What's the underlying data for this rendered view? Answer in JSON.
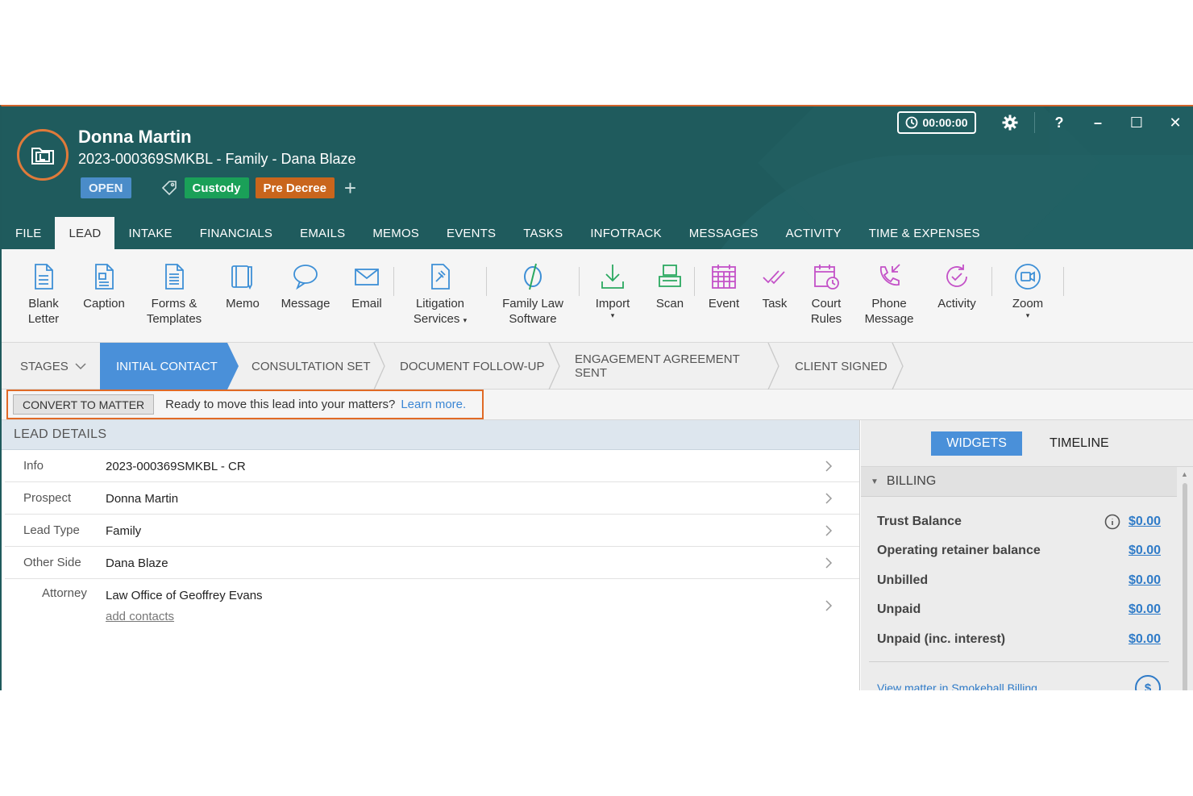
{
  "header": {
    "title": "Donna Martin",
    "subtitle": "2023-000369SMKBL - Family - Dana Blaze",
    "status": "OPEN",
    "tags": [
      "Custody",
      "Pre Decree"
    ],
    "timer": "00:00:00",
    "colors": {
      "header_bg": "#1f5b5d",
      "accent": "#d0642b",
      "custody": "#1aa058",
      "predecree": "#c9651c",
      "open": "#4a8cc9"
    }
  },
  "window": {
    "help": "?",
    "minimize": "–",
    "maximize": "☐",
    "close": "✕"
  },
  "tabs": [
    "FILE",
    "LEAD",
    "INTAKE",
    "FINANCIALS",
    "EMAILS",
    "MEMOS",
    "EVENTS",
    "TASKS",
    "INFOTRACK",
    "MESSAGES",
    "ACTIVITY",
    "TIME & EXPENSES"
  ],
  "active_tab": "LEAD",
  "ribbon": {
    "blank_letter": [
      "Blank",
      "Letter"
    ],
    "caption": "Caption",
    "forms": [
      "Forms &",
      "Templates"
    ],
    "memo": "Memo",
    "message": "Message",
    "email": "Email",
    "litigation": [
      "Litigation",
      "Services"
    ],
    "family_law": [
      "Family Law",
      "Software"
    ],
    "import": "Import",
    "scan": "Scan",
    "event": "Event",
    "task": "Task",
    "court_rules": [
      "Court",
      "Rules"
    ],
    "phone_message": [
      "Phone",
      "Message"
    ],
    "activity": "Activity",
    "zoom": "Zoom",
    "caret": "▾"
  },
  "stages": {
    "menu": "STAGES",
    "items": [
      "INITIAL CONTACT",
      "CONSULTATION SET",
      "DOCUMENT FOLLOW-UP",
      "ENGAGEMENT AGREEMENT SENT",
      "CLIENT SIGNED"
    ],
    "active": "INITIAL CONTACT"
  },
  "convert": {
    "button": "CONVERT TO MATTER",
    "text": "Ready to move this lead into your matters?",
    "link": "Learn more."
  },
  "lead_details": {
    "heading": "LEAD DETAILS",
    "rows": [
      {
        "label": "Info",
        "value": "2023-000369SMKBL - CR"
      },
      {
        "label": "Prospect",
        "value": "Donna Martin"
      },
      {
        "label": "Lead Type",
        "value": "Family"
      },
      {
        "label": "Other Side",
        "value": "Dana Blaze"
      },
      {
        "label": "Attorney",
        "value": "Law Office of Geoffrey Evans"
      }
    ],
    "add_contacts": "add contacts"
  },
  "side_panel": {
    "tabs": [
      "WIDGETS",
      "TIMELINE"
    ],
    "active": "WIDGETS",
    "billing": {
      "heading": "BILLING",
      "rows": [
        {
          "label": "Trust Balance",
          "amount": "$0.00"
        },
        {
          "label": "Operating retainer balance",
          "amount": "$0.00"
        },
        {
          "label": "Unbilled",
          "amount": "$0.00"
        },
        {
          "label": "Unpaid",
          "amount": "$0.00"
        },
        {
          "label": "Unpaid (inc. interest)",
          "amount": "$0.00"
        }
      ],
      "view_link": "View matter in Smokeball Billing",
      "dollar": "$"
    }
  }
}
